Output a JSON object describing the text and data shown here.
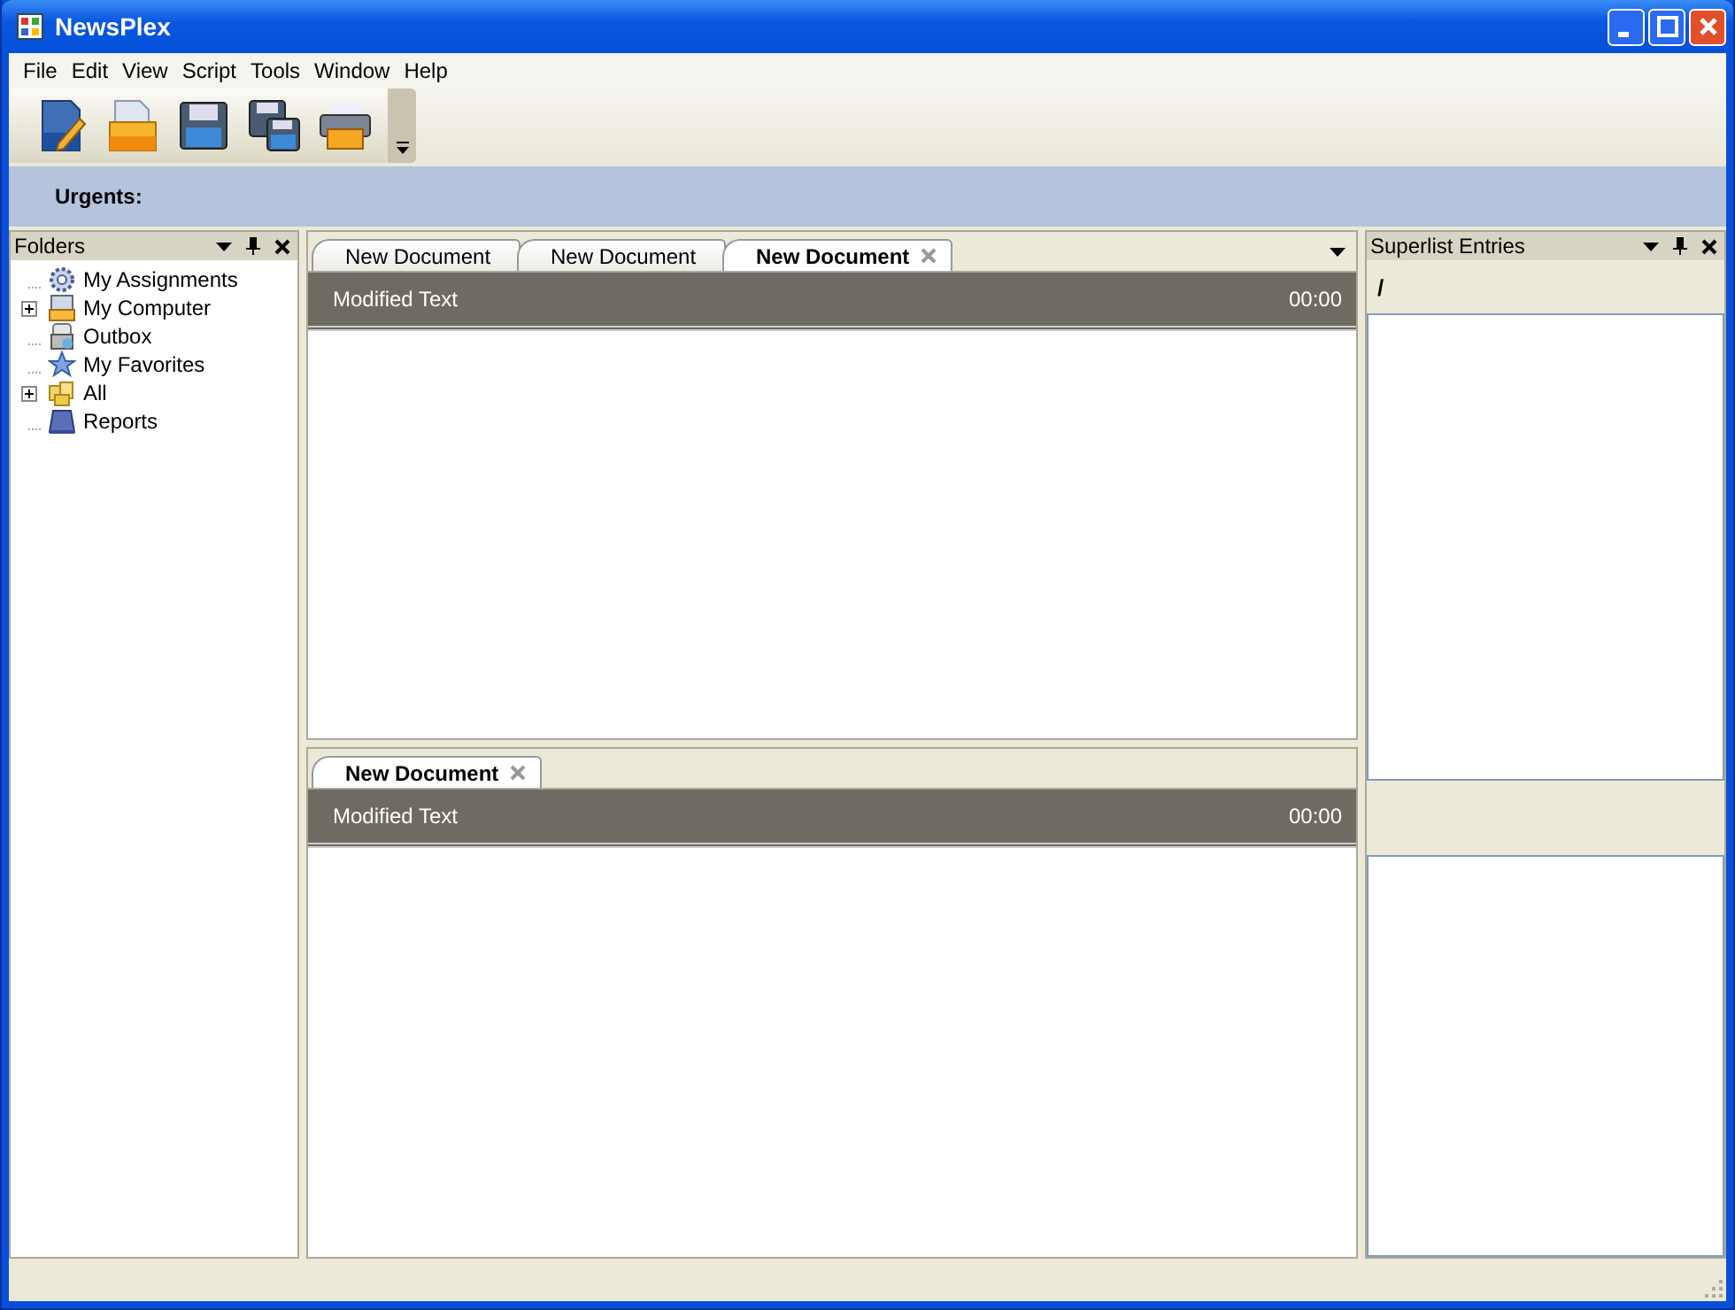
{
  "window": {
    "title": "NewsPlex"
  },
  "menu": [
    "File",
    "Edit",
    "View",
    "Script",
    "Tools",
    "Window",
    "Help"
  ],
  "urgents": {
    "label": "Urgents:"
  },
  "folders": {
    "title": "Folders",
    "items": [
      {
        "label": "My Assignments"
      },
      {
        "label": "My Computer",
        "expanded": false
      },
      {
        "label": "Outbox"
      },
      {
        "label": "My Favorites"
      },
      {
        "label": "All",
        "expanded": false
      },
      {
        "label": "Reports"
      }
    ]
  },
  "panes": [
    {
      "tabs": [
        {
          "label": "New Document",
          "selected": false
        },
        {
          "label": "New Document",
          "selected": false
        },
        {
          "label": "New Document",
          "selected": true
        }
      ],
      "header": {
        "text": "Modified Text",
        "time": "00:00"
      }
    },
    {
      "tabs": [
        {
          "label": "New Document",
          "selected": true
        }
      ],
      "header": {
        "text": "Modified Text",
        "time": "00:00"
      }
    }
  ],
  "superlist": {
    "title": "Superlist Entries",
    "path": "/"
  }
}
